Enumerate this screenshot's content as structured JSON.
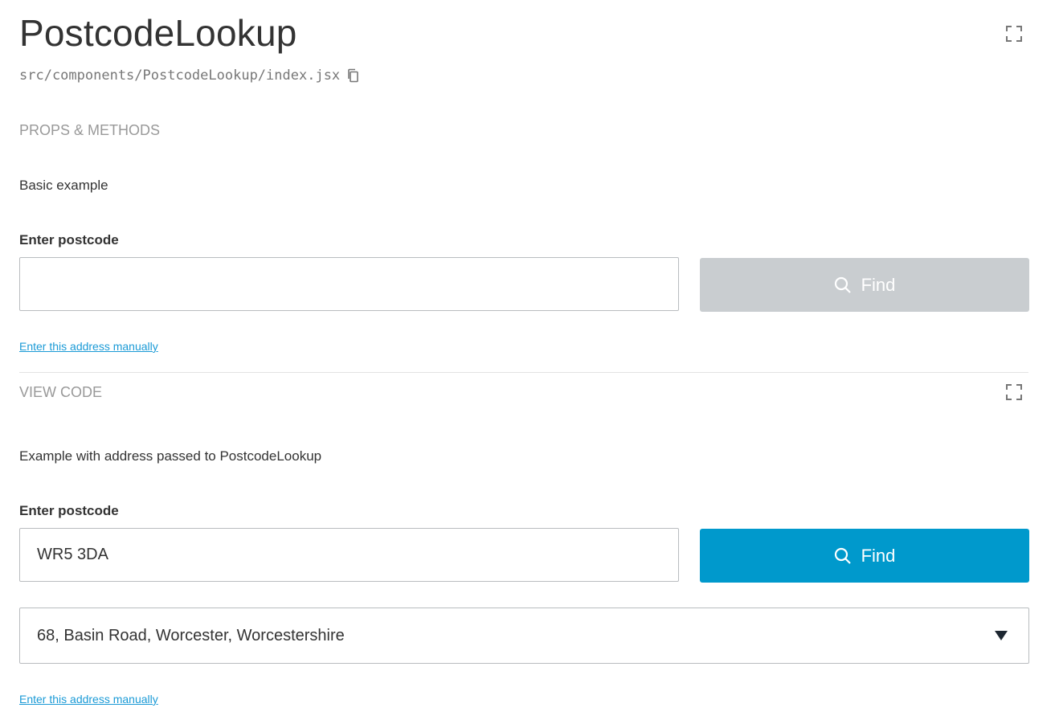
{
  "header": {
    "title": "PostcodeLookup",
    "path": "src/components/PostcodeLookup/index.jsx"
  },
  "props_methods_label": "PROPS & METHODS",
  "example1": {
    "description": "Basic example",
    "label": "Enter postcode",
    "input_value": "",
    "find_label": "Find",
    "manual_link": "Enter this address manually"
  },
  "view_code_label": "VIEW CODE",
  "example2": {
    "description": "Example with address passed to PostcodeLookup",
    "label": "Enter postcode",
    "input_value": "WR5 3DA",
    "find_label": "Find",
    "selected_address": "68, Basin Road, Worcester, Worcestershire",
    "manual_link": "Enter this address manually"
  },
  "colors": {
    "primary": "#0099cc",
    "disabled": "#c9cdd0",
    "link": "#1a9ad6"
  },
  "icons": {
    "copy": "copy-icon",
    "expand": "expand-icon",
    "search": "search-icon",
    "dropdown": "caret-down-icon"
  }
}
